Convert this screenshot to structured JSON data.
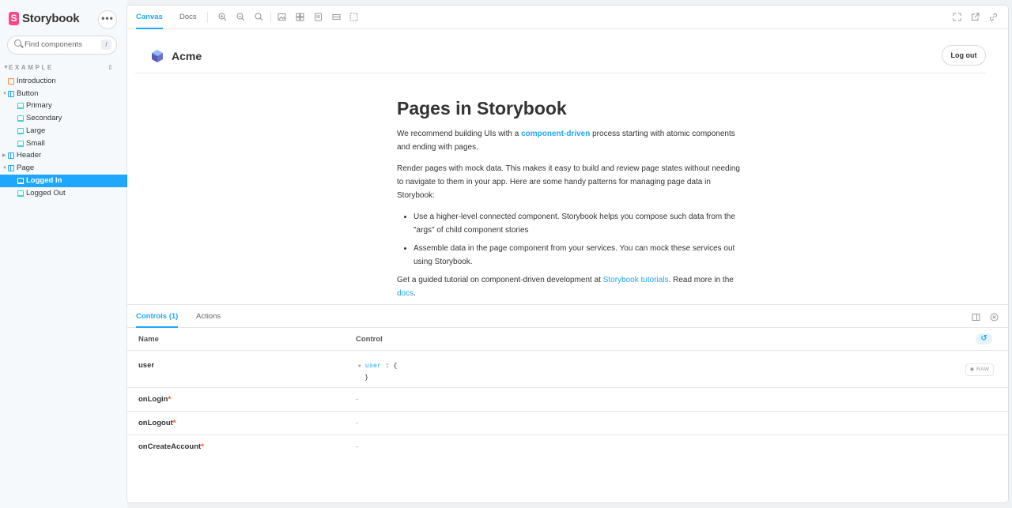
{
  "sidebar": {
    "brand": "Storybook",
    "brand_glyph": "S",
    "menu_glyph": "•••",
    "search": {
      "placeholder": "Find components",
      "shortcut": "/"
    },
    "section": "EXAMPLE",
    "items": [
      {
        "label": "Introduction",
        "type": "docs"
      },
      {
        "label": "Button",
        "type": "component",
        "expanded": true
      },
      {
        "label": "Primary",
        "type": "story"
      },
      {
        "label": "Secondary",
        "type": "story"
      },
      {
        "label": "Large",
        "type": "story"
      },
      {
        "label": "Small",
        "type": "story"
      },
      {
        "label": "Header",
        "type": "component",
        "expanded": false
      },
      {
        "label": "Page",
        "type": "component",
        "expanded": true
      },
      {
        "label": "Logged In",
        "type": "story",
        "selected": true
      },
      {
        "label": "Logged Out",
        "type": "story"
      }
    ]
  },
  "toolbar": {
    "tabs": [
      {
        "label": "Canvas",
        "active": true
      },
      {
        "label": "Docs",
        "active": false
      }
    ],
    "tools": [
      "zoom-in-icon",
      "zoom-out-icon",
      "zoom-reset-icon",
      "background-icon",
      "grid-icon",
      "viewport-icon",
      "measure-icon",
      "outline-icon",
      "fullscreen-icon",
      "new-tab-icon",
      "copy-link-icon"
    ]
  },
  "canvas": {
    "header": {
      "logo": "acme-logo",
      "title": "Acme",
      "logout_label": "Log out"
    },
    "article": {
      "title": "Pages in Storybook",
      "p1_a": "We recommend building UIs with a ",
      "p1_link": "component-driven",
      "p1_b": " process starting with atomic components and ending with pages.",
      "p2": "Render pages with mock data. This makes it easy to build and review page states without needing to navigate to them in your app. Here are some handy patterns for managing page data in Storybook:",
      "bullets": [
        "Use a higher-level connected component. Storybook helps you compose such data from the \"args\" of child component stories",
        "Assemble data in the page component from your services. You can mock these services out using Storybook."
      ],
      "p3_a": "Get a guided tutorial on component-driven development at ",
      "p3_link1": "Storybook tutorials",
      "p3_b": ". Read more in the ",
      "p3_link2": "docs",
      "p3_c": "."
    }
  },
  "addons": {
    "tabs": [
      {
        "label": "Controls (1)",
        "active": true
      },
      {
        "label": "Actions",
        "active": false
      }
    ],
    "columns": {
      "name": "Name",
      "control": "Control"
    },
    "undo_glyph": "↺",
    "rows": [
      {
        "name": "user",
        "required": false,
        "control_key": "user",
        "control_open": ": {",
        "control_close": "}",
        "raw_label": "RAW"
      },
      {
        "name": "onLogin",
        "required": true,
        "control": "-"
      },
      {
        "name": "onLogout",
        "required": true,
        "control": "-"
      },
      {
        "name": "onCreateAccount",
        "required": true,
        "control": "-"
      }
    ],
    "required_mark": "*"
  },
  "colors": {
    "accent": "#1ea7fd",
    "brand": "#ff4785",
    "required": "#ff4400",
    "selected_bg": "#1ea7fd"
  }
}
